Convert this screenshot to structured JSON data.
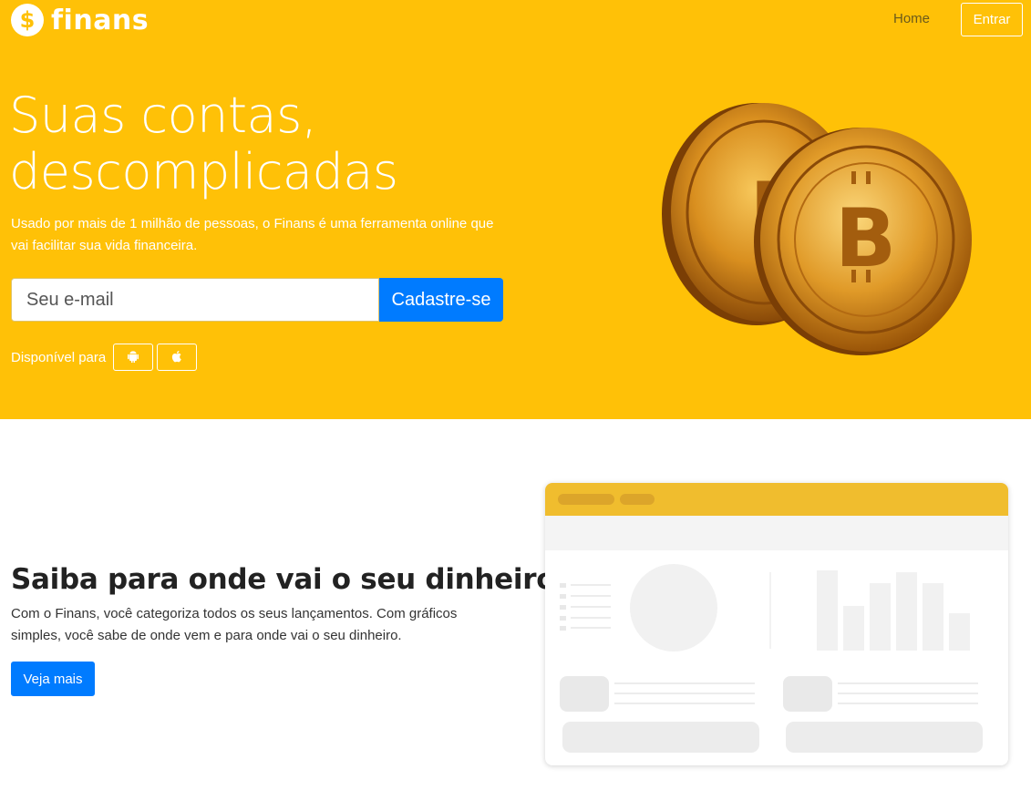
{
  "brand": {
    "name": "finans",
    "icon_glyph": "$"
  },
  "nav": {
    "home": "Home",
    "login": "Entrar"
  },
  "hero": {
    "title_line1": "Suas contas,",
    "title_line2": "descomplicadas",
    "subtitle": "Usado por mais de 1 milhão de pessoas, o Finans é uma ferramenta online que vai facilitar sua vida financeira.",
    "email_placeholder": "Seu e-mail",
    "signup_label": "Cadastre-se",
    "available_label": "Disponível para",
    "stores": [
      "android-icon",
      "apple-icon"
    ]
  },
  "feature": {
    "title": "Saiba para onde vai o seu dinheiro",
    "text": "Com o Finans, você categoriza todos os seus lançamentos. Com gráficos simples, você sabe de onde vem e para onde vai o seu dinheiro.",
    "button": "Veja mais"
  },
  "colors": {
    "hero_bg": "#ffc107",
    "primary": "#007bff",
    "mock_header": "#f0bd2e"
  }
}
